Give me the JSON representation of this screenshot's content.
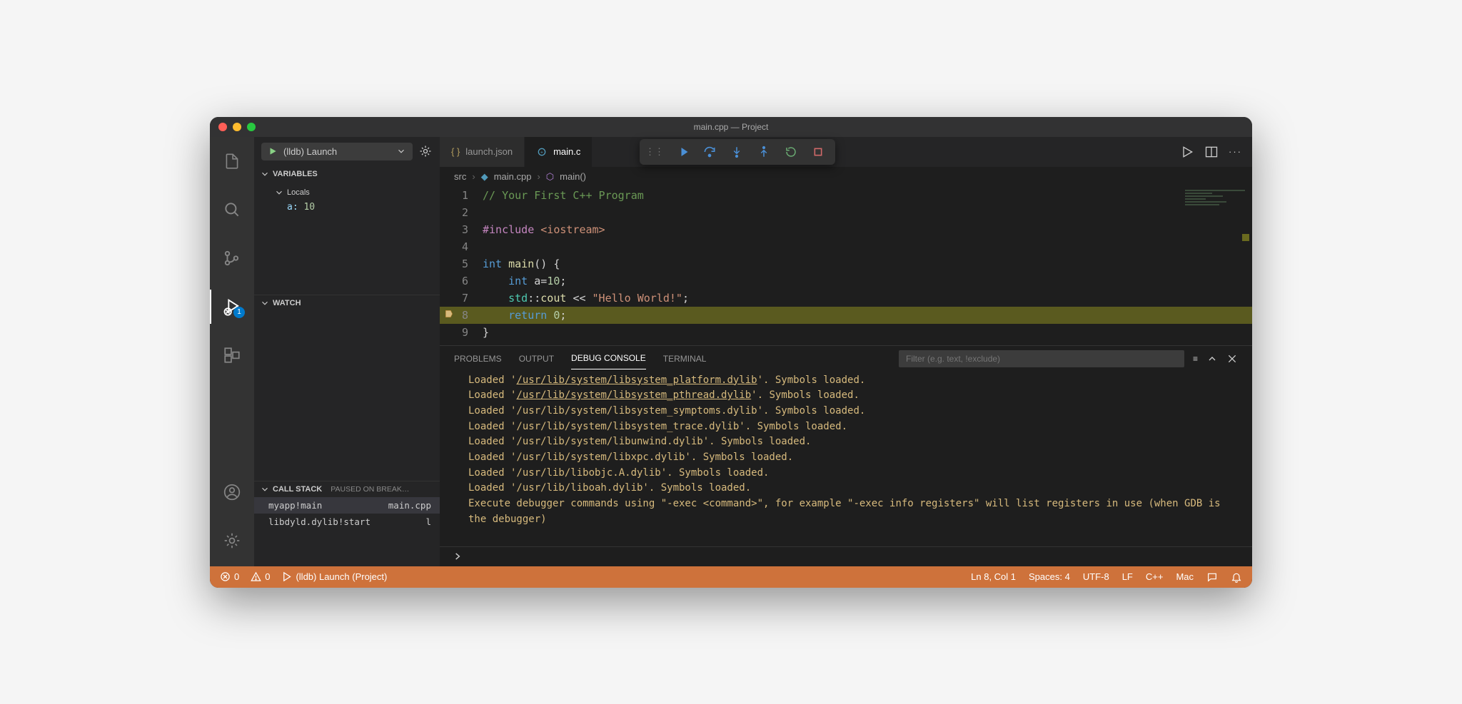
{
  "window": {
    "title": "main.cpp — Project"
  },
  "activity": {
    "debug_badge": "1"
  },
  "debugConfig": {
    "label": "(lldb) Launch"
  },
  "sections": {
    "variables_label": "VARIABLES",
    "locals_label": "Locals",
    "watch_label": "WATCH",
    "callstack_label": "CALL STACK",
    "callstack_status": "PAUSED ON BREAK…"
  },
  "variables": {
    "a_name": "a:",
    "a_value": "10"
  },
  "callstack": [
    {
      "frame": "myapp!main",
      "file": "main.cpp"
    },
    {
      "frame": "libdyld.dylib!start",
      "file": "l"
    }
  ],
  "tabs": [
    {
      "label": "launch.json",
      "active": false
    },
    {
      "label": "main.c",
      "active": true
    }
  ],
  "breadcrumb": {
    "p0": "src",
    "p1": "main.cpp",
    "p2": "main()"
  },
  "editor": {
    "lines": [
      "// Your First C++ Program",
      "",
      "#include <iostream>",
      "",
      "int main() {",
      "    int a=10;",
      "    std::cout << \"Hello World!\";",
      "    return 0;",
      "}"
    ],
    "current_line": 8
  },
  "panel": {
    "tabs": {
      "problems": "PROBLEMS",
      "output": "OUTPUT",
      "debug": "DEBUG CONSOLE",
      "terminal": "TERMINAL"
    },
    "filter_placeholder": "Filter (e.g. text, !exclude)",
    "console": [
      {
        "prefix": "Loaded '",
        "link": "/usr/lib/system/libsystem_platform.dylib",
        "suffix": "'. Symbols loaded."
      },
      {
        "prefix": "Loaded '",
        "link": "/usr/lib/system/libsystem_pthread.dylib",
        "suffix": "'. Symbols loaded."
      },
      {
        "text": "Loaded '/usr/lib/system/libsystem_symptoms.dylib'. Symbols loaded."
      },
      {
        "text": "Loaded '/usr/lib/system/libsystem_trace.dylib'. Symbols loaded."
      },
      {
        "text": "Loaded '/usr/lib/system/libunwind.dylib'. Symbols loaded."
      },
      {
        "text": "Loaded '/usr/lib/system/libxpc.dylib'. Symbols loaded."
      },
      {
        "text": "Loaded '/usr/lib/libobjc.A.dylib'. Symbols loaded."
      },
      {
        "text": "Loaded '/usr/lib/liboah.dylib'. Symbols loaded."
      },
      {
        "text": "Execute debugger commands using \"-exec <command>\", for example \"-exec info registers\" will list registers in use (when GDB is the debugger)"
      }
    ]
  },
  "status": {
    "errors": "0",
    "warnings": "0",
    "launch": "(lldb) Launch (Project)",
    "lncol": "Ln 8, Col 1",
    "spaces": "Spaces: 4",
    "encoding": "UTF-8",
    "eol": "LF",
    "lang": "C++",
    "os": "Mac"
  }
}
